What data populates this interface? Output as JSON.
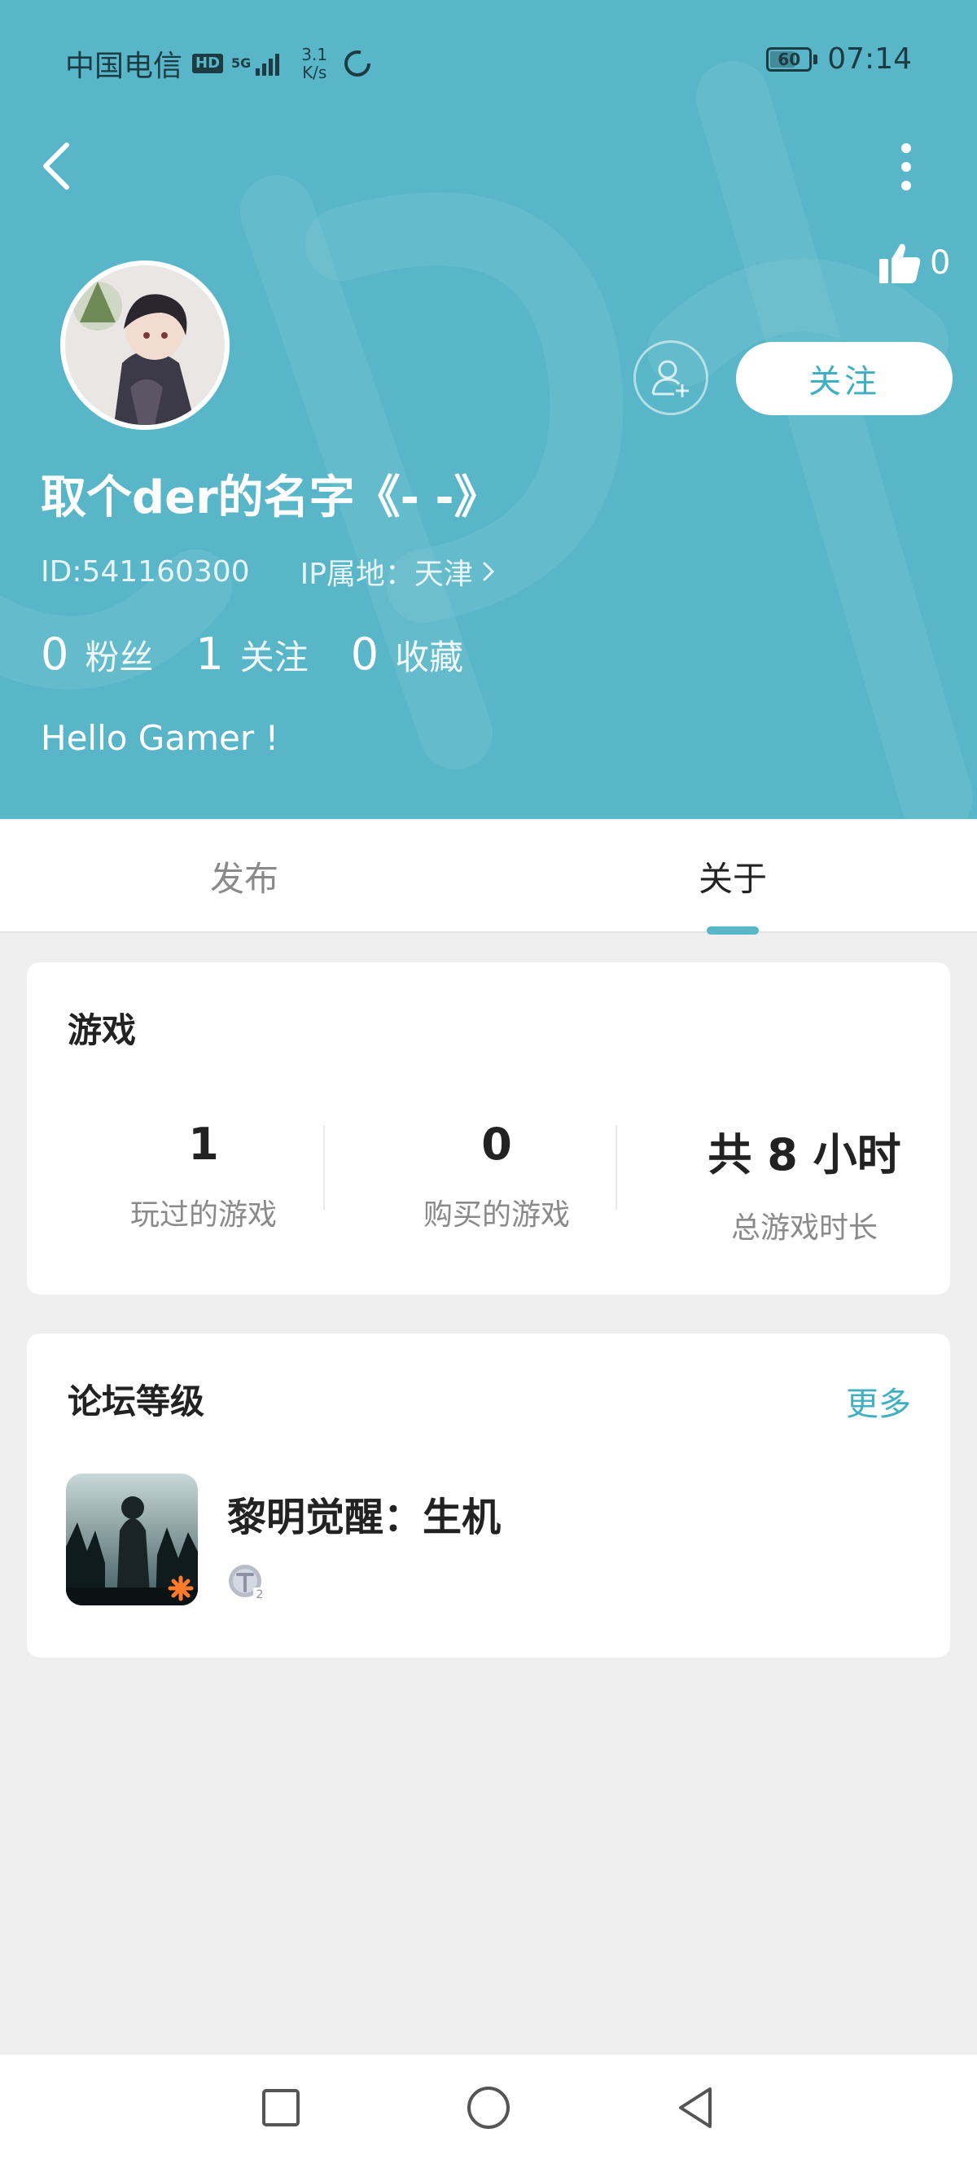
{
  "statusbar": {
    "carrier": "中国电信",
    "hd": "HD",
    "network": "5G",
    "speed_value": "3.1",
    "speed_unit": "K/s",
    "battery": "60",
    "time": "07:14"
  },
  "header": {
    "like_count": "0",
    "follow_label": "关注",
    "username": "取个der的名字《- -》",
    "id_text": "ID:541160300",
    "ip_text": "IP属地：天津",
    "stats": [
      {
        "value": "0",
        "label": "粉丝"
      },
      {
        "value": "1",
        "label": "关注"
      },
      {
        "value": "0",
        "label": "收藏"
      }
    ],
    "bio": "Hello Gamer !"
  },
  "tabs": [
    {
      "label": "发布",
      "active": false
    },
    {
      "label": "关于",
      "active": true
    }
  ],
  "games_card": {
    "title": "游戏",
    "metrics": [
      {
        "value": "1",
        "label": "玩过的游戏"
      },
      {
        "value": "0",
        "label": "购买的游戏"
      },
      {
        "value": "共 8 小时",
        "label": "总游戏时长"
      }
    ]
  },
  "forum_card": {
    "title": "论坛等级",
    "more_label": "更多",
    "game_name": "黎明觉醒：生机",
    "level_badge": "2"
  },
  "colors": {
    "header_bg": "#58b6c8",
    "accent": "#3fb0c3",
    "page_bg": "#efefef"
  },
  "icons": {
    "back": "chevron-left-icon",
    "more": "more-vertical-icon",
    "like": "thumbs-up-icon",
    "add_friend": "add-user-icon",
    "ip_chevron": "chevron-right-icon"
  }
}
